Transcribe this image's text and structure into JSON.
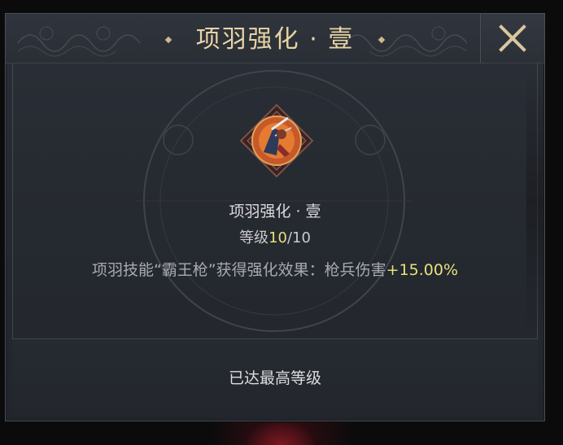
{
  "header": {
    "title": "项羽强化 · 壹",
    "close_icon": "close-icon"
  },
  "skill": {
    "icon": "xiang-yu-warrior-portrait",
    "name": "项羽强化 · 壹",
    "level_label": "等级",
    "level_current": "10",
    "level_sep_max": "/10"
  },
  "description": {
    "text": "项羽技能“霸王枪”获得强化效果：枪兵伤害",
    "bonus": "+15.00%"
  },
  "footer": {
    "status": "已达最高等级"
  },
  "colors": {
    "title": "#e7d3a6",
    "highlight": "#e6e07a",
    "panel": "#2a2e35"
  }
}
